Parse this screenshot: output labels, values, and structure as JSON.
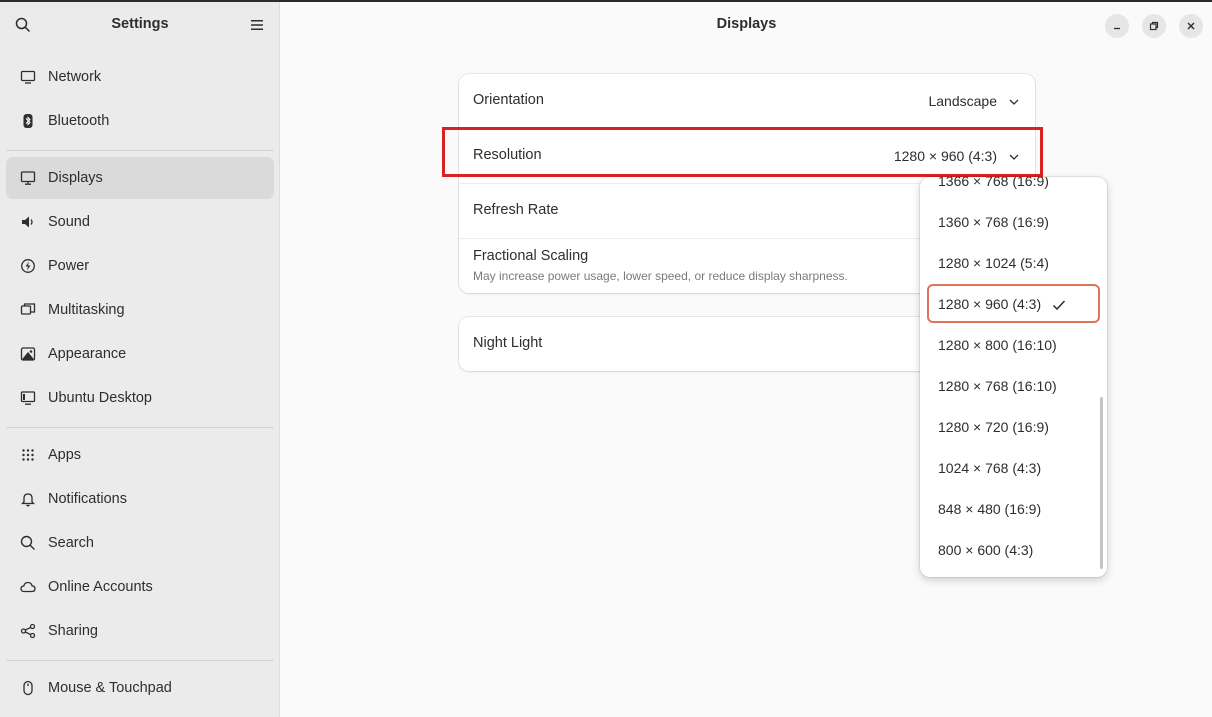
{
  "app": {
    "sidebar_title": "Settings",
    "page_title": "Displays"
  },
  "sidebar": {
    "items": [
      {
        "label": "Network",
        "icon": "network-icon"
      },
      {
        "label": "Bluetooth",
        "icon": "bluetooth-icon"
      },
      {
        "label": "Displays",
        "icon": "display-icon",
        "selected": true
      },
      {
        "label": "Sound",
        "icon": "sound-icon"
      },
      {
        "label": "Power",
        "icon": "power-icon"
      },
      {
        "label": "Multitasking",
        "icon": "multitasking-icon"
      },
      {
        "label": "Appearance",
        "icon": "appearance-icon"
      },
      {
        "label": "Ubuntu Desktop",
        "icon": "ubuntu-desktop-icon"
      },
      {
        "label": "Apps",
        "icon": "apps-icon"
      },
      {
        "label": "Notifications",
        "icon": "bell-icon"
      },
      {
        "label": "Search",
        "icon": "search-icon"
      },
      {
        "label": "Online Accounts",
        "icon": "cloud-icon"
      },
      {
        "label": "Sharing",
        "icon": "share-icon"
      },
      {
        "label": "Mouse & Touchpad",
        "icon": "mouse-icon"
      }
    ]
  },
  "settings": {
    "orientation": {
      "label": "Orientation",
      "value": "Landscape"
    },
    "resolution": {
      "label": "Resolution",
      "value": "1280 × 960 (4:3)"
    },
    "refresh_rate": {
      "label": "Refresh Rate"
    },
    "fractional_scaling": {
      "label": "Fractional Scaling",
      "subtitle": "May increase power usage, lower speed, or reduce display sharpness."
    },
    "night_light": {
      "label": "Night Light"
    }
  },
  "resolution_dropdown": {
    "options": [
      "1366 × 768 (16:9)",
      "1360 × 768 (16:9)",
      "1280 × 1024 (5:4)",
      "1280 × 960 (4:3)",
      "1280 × 800 (16:10)",
      "1280 × 768 (16:10)",
      "1280 × 720 (16:9)",
      "1024 × 768 (4:3)",
      "848 × 480 (16:9)",
      "800 × 600 (4:3)"
    ],
    "selected": "1280 × 960 (4:3)"
  },
  "colors": {
    "highlight_box": "#d9221f",
    "selected_option_border": "#e1735a"
  }
}
